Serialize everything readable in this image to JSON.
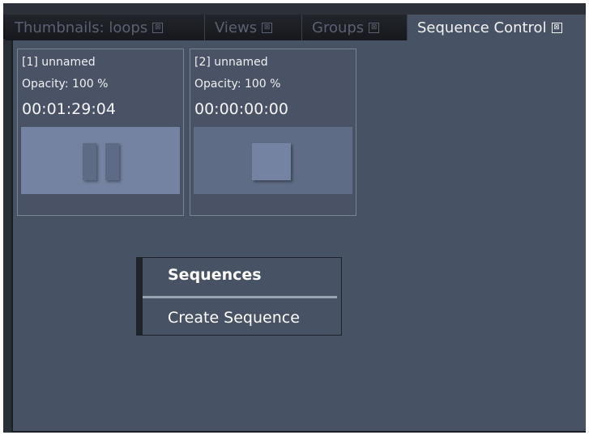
{
  "tabs": [
    {
      "label": "Thumbnails: loops",
      "close": "⊠"
    },
    {
      "label": "Views",
      "close": "⊠"
    },
    {
      "label": "Groups",
      "close": "⊠"
    },
    {
      "label": "Sequence Control",
      "close": "⊠"
    }
  ],
  "active_tab": "Sequence Control",
  "sequences": [
    {
      "name": "[1] unnamed",
      "opacity": "Opacity: 100 %",
      "time": "00:01:29:04",
      "state_icon": "pause-icon"
    },
    {
      "name": "[2] unnamed",
      "opacity": "Opacity: 100 %",
      "time": "00:00:00:00",
      "state_icon": "stop-icon"
    }
  ],
  "context_menu": {
    "header": "Sequences",
    "items": [
      "Create Sequence"
    ]
  },
  "colors": {
    "panel_bg": "#475264",
    "preview_bg": "#7483a1",
    "text": "#f0f0f0"
  }
}
